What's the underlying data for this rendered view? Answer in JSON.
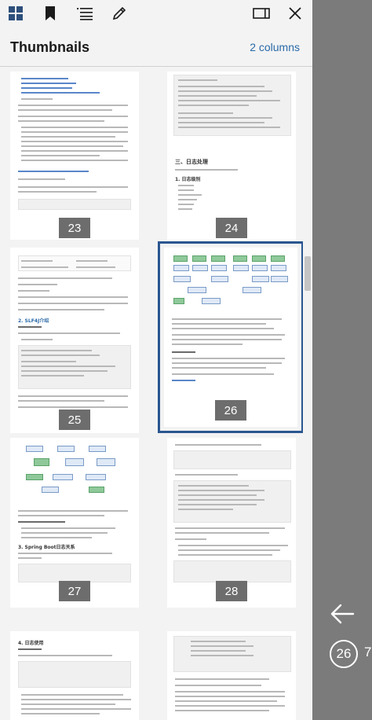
{
  "toolbar": {
    "icons": [
      "thumbnails-icon",
      "bookmark-icon",
      "outline-icon",
      "annotate-icon",
      "dual-pane-icon",
      "close-icon"
    ]
  },
  "panel": {
    "title": "Thumbnails",
    "columns_label": "2 columns"
  },
  "thumbnails": [
    {
      "page": "23"
    },
    {
      "page": "24",
      "heading1": "三、日志处理",
      "heading2": "1. 日志级别"
    },
    {
      "page": "25",
      "heading": "2. SLF4J介绍"
    },
    {
      "page": "26"
    },
    {
      "page": "27",
      "heading": "3. Spring Boot日志关系"
    },
    {
      "page": "28"
    },
    {
      "page": "",
      "heading": "4. 日志使用"
    },
    {
      "page": ""
    }
  ],
  "viewer": {
    "current_page": "26",
    "page_suffix": "7"
  }
}
